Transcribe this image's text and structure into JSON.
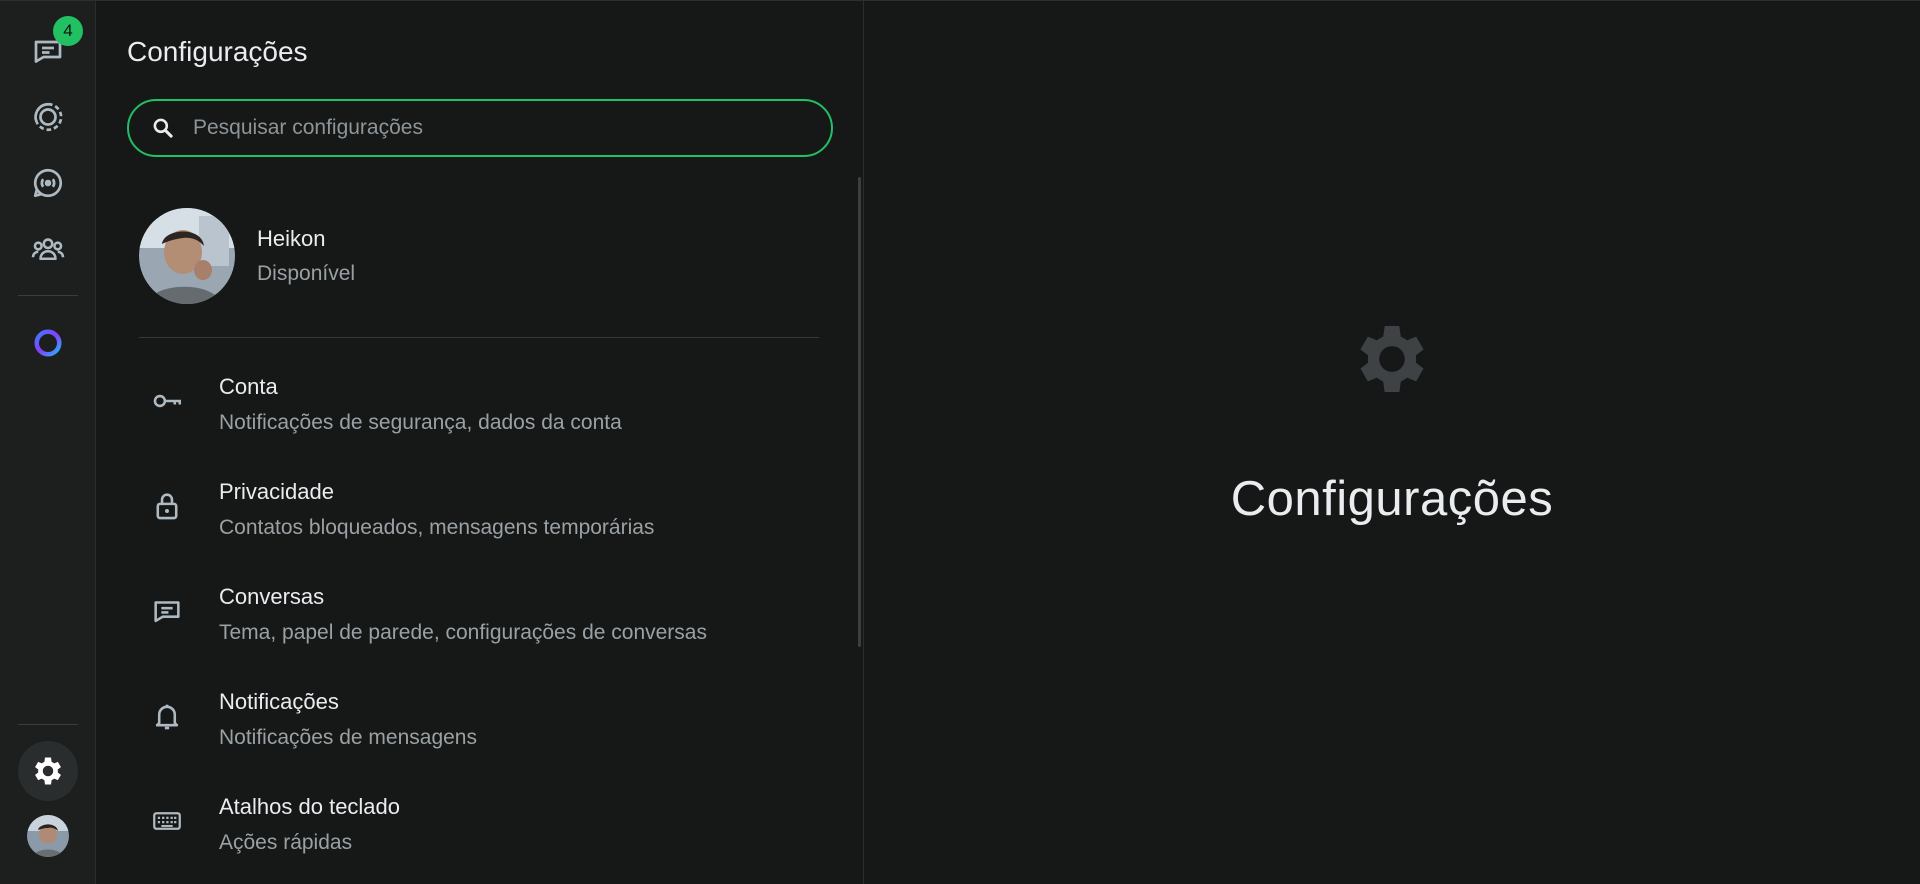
{
  "rail": {
    "chats_badge": "4",
    "items": [
      {
        "name": "chats",
        "icon": "chats-icon"
      },
      {
        "name": "status",
        "icon": "status-icon"
      },
      {
        "name": "channels",
        "icon": "channels-icon"
      },
      {
        "name": "communities",
        "icon": "communities-icon"
      },
      {
        "name": "meta-ai",
        "icon": "meta-ai-icon"
      },
      {
        "name": "settings",
        "icon": "gear-icon"
      },
      {
        "name": "profile",
        "icon": "avatar"
      }
    ]
  },
  "panel": {
    "title": "Configurações",
    "search_placeholder": "Pesquisar configurações",
    "search_value": ""
  },
  "profile": {
    "name": "Heikon",
    "status": "Disponível"
  },
  "menu": [
    {
      "label": "Conta",
      "desc": "Notificações de segurança, dados da conta",
      "icon": "key-icon"
    },
    {
      "label": "Privacidade",
      "desc": "Contatos bloqueados, mensagens temporárias",
      "icon": "lock-icon"
    },
    {
      "label": "Conversas",
      "desc": "Tema, papel de parede, configurações de conversas",
      "icon": "chat-icon"
    },
    {
      "label": "Notificações",
      "desc": "Notificações de mensagens",
      "icon": "bell-icon"
    },
    {
      "label": "Atalhos do teclado",
      "desc": "Ações rápidas",
      "icon": "keyboard-icon"
    }
  ],
  "main": {
    "title": "Configurações",
    "icon": "gear-icon"
  },
  "colors": {
    "accent": "#21c063",
    "background": "#161717",
    "rail": "#1d1f1f"
  }
}
